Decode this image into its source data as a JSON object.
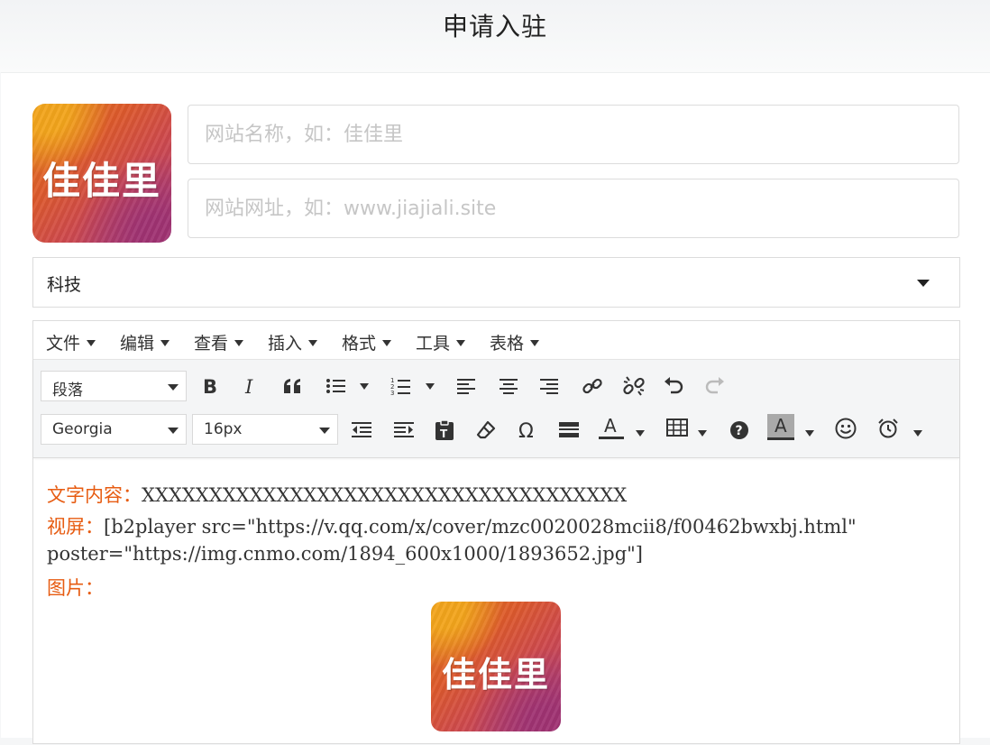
{
  "header": {
    "title": "申请入驻"
  },
  "logo": {
    "text": "佳佳里"
  },
  "form": {
    "site_name_placeholder": "网站名称，如：佳佳里",
    "site_url_placeholder": "网站网址，如：www.jiajiali.site",
    "category_value": "科技"
  },
  "editor": {
    "menus": [
      "文件",
      "编辑",
      "查看",
      "插入",
      "格式",
      "工具",
      "表格"
    ],
    "block_format": "段落",
    "font_family": "Georgia",
    "font_size": "16px",
    "content": {
      "text_label": "文字内容：",
      "text_value": "XXXXXXXXXXXXXXXXXXXXXXXXXXXXXXXXXXXX",
      "video_label": "视屏：",
      "video_value_line1": "[b2player src=\"https://v.qq.com/x/cover/mzc0020028mcii8/f00462bwxbj.html\"",
      "video_value_line2": "poster=\"https://img.cnmo.com/1894_600x1000/1893652.jpg\"]",
      "image_label": "图片："
    }
  },
  "colors": {
    "accent": "#e75c12",
    "border": "#dcdcdc",
    "toolbar_bg": "#f4f5f6"
  },
  "icons": [
    "bold-icon",
    "italic-icon",
    "blockquote-icon",
    "bullet-list-icon",
    "numbered-list-icon",
    "align-left-icon",
    "align-center-icon",
    "align-right-icon",
    "link-icon",
    "unlink-icon",
    "undo-icon",
    "redo-icon",
    "outdent-icon",
    "indent-icon",
    "paste-text-icon",
    "clear-format-icon",
    "special-char-icon",
    "horizontal-rule-icon",
    "text-color-icon",
    "table-icon",
    "help-icon",
    "background-color-icon",
    "emoticons-icon",
    "alarm-icon"
  ]
}
